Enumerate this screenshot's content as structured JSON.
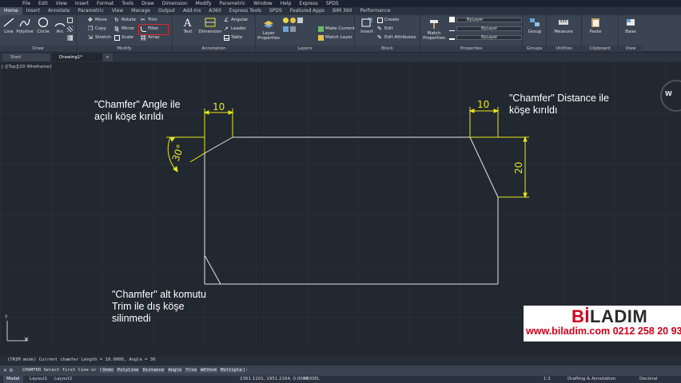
{
  "menu": [
    "File",
    "Edit",
    "View",
    "Insert",
    "Format",
    "Tools",
    "Draw",
    "Dimension",
    "Modify",
    "Parametric",
    "Window",
    "Help",
    "Express",
    "SPDS"
  ],
  "ribbon_tabs": [
    "Home",
    "Insert",
    "Annotate",
    "Parametric",
    "View",
    "Manage",
    "Output",
    "Add-ins",
    "A360",
    "Express Tools",
    "SPDS",
    "Featured Apps",
    "BIM 360",
    "Performance"
  ],
  "draw": {
    "title": "Draw",
    "line": "Line",
    "polyline": "Polyline",
    "circle": "Circle",
    "arc": "Arc"
  },
  "modify": {
    "title": "Modify",
    "move": "Move",
    "rotate": "Rotate",
    "trim": "Trim",
    "copy": "Copy",
    "mirror": "Mirror",
    "fillet": "Fillet",
    "stretch": "Stretch",
    "scale": "Scale",
    "array": "Array"
  },
  "annotation": {
    "title": "Annotation",
    "text": "Text",
    "dimension": "Dimension",
    "angular": "Angular",
    "leader": "Leader",
    "table": "Table"
  },
  "layers": {
    "title": "Layers",
    "layer_properties_1": "Layer",
    "layer_properties_2": "Properties",
    "make_current": "Make Current",
    "match_layer": "Match Layer"
  },
  "block": {
    "title": "Block",
    "insert": "Insert",
    "create": "Create",
    "edit": "Edit",
    "edit_attributes": "Edit Attributes"
  },
  "properties": {
    "title": "Properties",
    "match_1": "Match",
    "match_2": "Properties",
    "bylayer_1": "ByLayer",
    "bylayer_2": "ByLayer",
    "bylayer_3": "ByLayer"
  },
  "groups": {
    "title": "Groups",
    "group": "Group"
  },
  "utilities": {
    "title": "Utilities",
    "measure": "Measure"
  },
  "clipboard": {
    "title": "Clipboard",
    "paste": "Paste"
  },
  "view": {
    "title": "View",
    "base": "Base"
  },
  "file_tabs": {
    "start": "Start",
    "drawing": "Drawing1*",
    "add": "+"
  },
  "viewport_label": "[-][Top][2D Wireframe]",
  "compass_letter": "W",
  "dims": {
    "angle": "30°",
    "dist_top_left": "10",
    "dist_top_right": "10",
    "dist_right": "20"
  },
  "notes": {
    "angle_1": "\"Chamfer\" Angle ile",
    "angle_2": "açılı köşe kırıldı",
    "distance_1": "\"Chamfer\" Distance ile",
    "distance_2": "köşe kırıldı",
    "trim_1": "\"Chamfer\" alt komutu",
    "trim_2": "Trim ile dış köşe",
    "trim_3": "silinmedi"
  },
  "brand": {
    "part1": "Bİ",
    "part2": "LADIM",
    "url": "www.biladim.com 0212 258 20 93"
  },
  "command_history": "(TRIM mode) Current chamfer Length = 10.0000, Angle = 30",
  "command_prompt": "CHAMFER Select first line or [",
  "command_options": [
    "Undo",
    "Polyline",
    "Distance",
    "Angle",
    "Trim",
    "mEthod",
    "Multiple"
  ],
  "command_end": "]:",
  "layout_tabs": [
    "Model",
    "Layout1",
    "Layout2"
  ],
  "status": {
    "coords": "2361.1101, 1951.2164, 0.0000",
    "model": "MODEL",
    "scale": "1:1",
    "workspace": "Drafting & Annotation",
    "units": "Decimal"
  },
  "colors": {
    "dim_yellow": "#e8e81a",
    "geometry": "#e6e6e6",
    "highlight_red": "#e02a2a",
    "brand_red": "#d3001b"
  }
}
